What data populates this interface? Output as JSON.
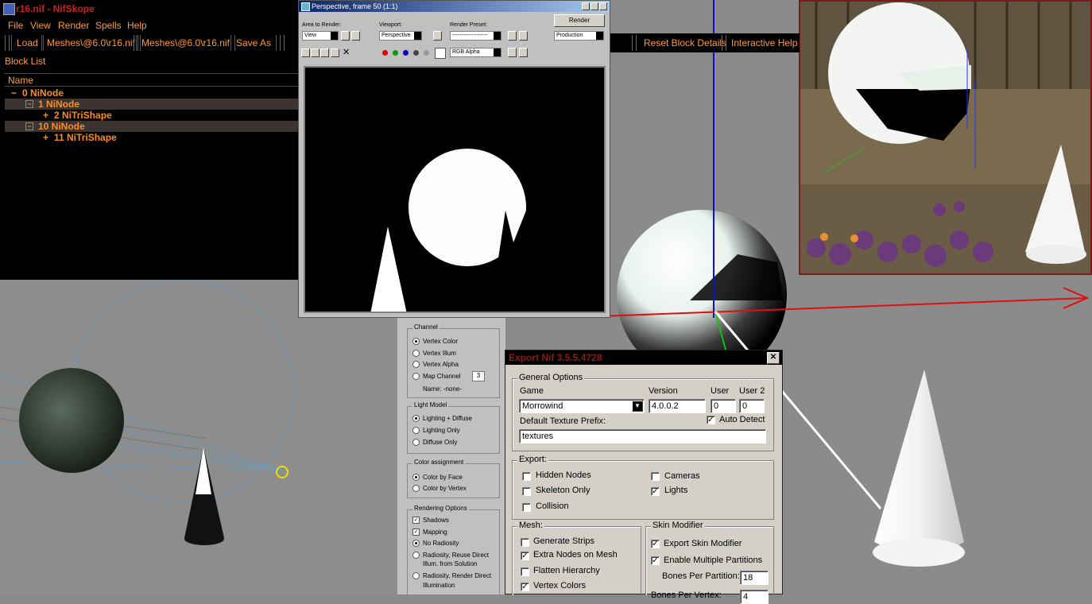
{
  "nifskope": {
    "title": "r16.nif - NifSkope",
    "menu": [
      "File",
      "View",
      "Render",
      "Spells",
      "Help"
    ],
    "toolbar": {
      "load": "Load",
      "path1": "Meshes\\@6.0\\r16.nif",
      "path2": "Meshes\\@6.0\\r16.nif",
      "save_as": "Save As",
      "reset": "Reset Block Details",
      "help": "Interactive Help"
    },
    "block_list_label": "Block List",
    "column_header": "Name",
    "tree": [
      {
        "expander": "−",
        "label": "0  NiNode"
      },
      {
        "expander": "−",
        "label": "1  NiNode"
      },
      {
        "expander": "+",
        "label": "2  NiTriShape"
      },
      {
        "expander": "−",
        "label": "10  NiNode"
      },
      {
        "expander": "+",
        "label": "11  NiTriShape"
      }
    ]
  },
  "render_window": {
    "title": "Perspective, frame 50 (1:1)",
    "area_label": "Area to Render:",
    "area_value": "View",
    "viewport_label": "Viewport:",
    "viewport_value": "Perspective",
    "preset_label": "Render Preset:",
    "preset_value": "-------------------",
    "render_button": "Render",
    "mode_value": "Production",
    "channel_value": "RGB Alpha"
  },
  "rollout": {
    "channel_title": "Channel",
    "channel_items": [
      "Vertex Color",
      "Vertex Illum",
      "Vertex Alpha",
      "Map Channel"
    ],
    "map_channel_value": "3",
    "name_text": "Name: -none-",
    "light_title": "Light Model",
    "light_items": [
      "Lighting + Diffuse",
      "Lighting Only",
      "Diffuse Only"
    ],
    "color_title": "Color assignment",
    "color_items": [
      "Color by Face",
      "Color by Vertex"
    ],
    "rendering_title": "Rendering Options",
    "rendering_items": [
      "Shadows",
      "Mapping",
      "No Radiosity",
      "Radiosity, Reuse Direct",
      "Illum. from Solution",
      "Radiosity, Render Direct",
      "Illumination"
    ]
  },
  "export_dialog": {
    "title": "Export Nif 3.5.5.4728",
    "general_title": "General Options",
    "game_label": "Game",
    "game_value": "Morrowind",
    "version_label": "Version",
    "version_value": "4.0.0.2",
    "user_label": "User",
    "user_value": "0",
    "user2_label": "User 2",
    "user2_value": "0",
    "auto_detect_label": "Auto Detect",
    "prefix_label": "Default Texture Prefix:",
    "prefix_value": "textures",
    "export_title": "Export:",
    "hidden_nodes": "Hidden Nodes",
    "skeleton_only": "Skeleton Only",
    "collision": "Collision",
    "cameras": "Cameras",
    "lights": "Lights",
    "mesh_title": "Mesh:",
    "generate_strips": "Generate Strips",
    "extra_nodes": "Extra Nodes on Mesh",
    "flatten": "Flatten Hierarchy",
    "vertex_colors": "Vertex Colors",
    "skin_title": "Skin Modifier",
    "export_skin": "Export Skin Modifier",
    "multi_partitions": "Enable Multiple Partitions",
    "bones_per_partition_label": "Bones Per Partition:",
    "bones_per_partition_value": "18",
    "bones_per_vertex_label": "Bones Per Vertex:",
    "bones_per_vertex_value": "4"
  },
  "colors": {
    "nif_accent": "#ff8c1a",
    "export_title": "#8b1a1a",
    "axis_red": "#e01010",
    "axis_blue": "#1010d0",
    "axis_green": "#10c010"
  }
}
